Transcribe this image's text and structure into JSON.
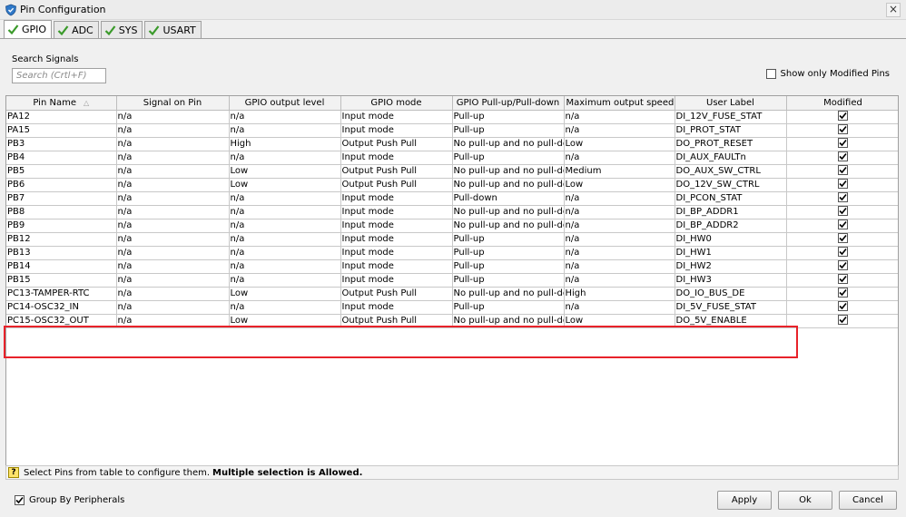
{
  "window": {
    "title": "Pin Configuration",
    "close_symbol": "×"
  },
  "tabs": [
    {
      "label": "GPIO",
      "icon": "check-icon",
      "active": true
    },
    {
      "label": "ADC",
      "icon": "check-icon",
      "active": false
    },
    {
      "label": "SYS",
      "icon": "check-icon",
      "active": false
    },
    {
      "label": "USART",
      "icon": "check-icon",
      "active": false
    }
  ],
  "search": {
    "label": "Search Signals",
    "placeholder": "Search (Crtl+F)",
    "value": ""
  },
  "show_modified": {
    "label": "Show only Modified Pins",
    "checked": false
  },
  "table": {
    "columns": [
      "Pin Name",
      "Signal on Pin",
      "GPIO output level",
      "GPIO mode",
      "GPIO Pull-up/Pull-down",
      "Maximum output speed",
      "User Label",
      "Modified"
    ],
    "sort_column": "Pin Name",
    "sort_glyph": "△",
    "rows": [
      {
        "pin": "PA12",
        "signal": "n/a",
        "level": "n/a",
        "mode": "Input mode",
        "pull": "Pull-up",
        "speed": "n/a",
        "label": "DI_12V_FUSE_STAT",
        "modified": true
      },
      {
        "pin": "PA15",
        "signal": "n/a",
        "level": "n/a",
        "mode": "Input mode",
        "pull": "Pull-up",
        "speed": "n/a",
        "label": "DI_PROT_STAT",
        "modified": true
      },
      {
        "pin": "PB3",
        "signal": "n/a",
        "level": "High",
        "mode": "Output Push Pull",
        "pull": "No pull-up and no pull-down",
        "speed": "Low",
        "label": "DO_PROT_RESET",
        "modified": true
      },
      {
        "pin": "PB4",
        "signal": "n/a",
        "level": "n/a",
        "mode": "Input mode",
        "pull": "Pull-up",
        "speed": "n/a",
        "label": "DI_AUX_FAULTn",
        "modified": true
      },
      {
        "pin": "PB5",
        "signal": "n/a",
        "level": "Low",
        "mode": "Output Push Pull",
        "pull": "No pull-up and no pull-down",
        "speed": "Medium",
        "label": "DO_AUX_SW_CTRL",
        "modified": true
      },
      {
        "pin": "PB6",
        "signal": "n/a",
        "level": "Low",
        "mode": "Output Push Pull",
        "pull": "No pull-up and no pull-down",
        "speed": "Low",
        "label": "DO_12V_SW_CTRL",
        "modified": true
      },
      {
        "pin": "PB7",
        "signal": "n/a",
        "level": "n/a",
        "mode": "Input mode",
        "pull": "Pull-down",
        "speed": "n/a",
        "label": "DI_PCON_STAT",
        "modified": true
      },
      {
        "pin": "PB8",
        "signal": "n/a",
        "level": "n/a",
        "mode": "Input mode",
        "pull": "No pull-up and no pull-down",
        "speed": "n/a",
        "label": "DI_BP_ADDR1",
        "modified": true
      },
      {
        "pin": "PB9",
        "signal": "n/a",
        "level": "n/a",
        "mode": "Input mode",
        "pull": "No pull-up and no pull-down",
        "speed": "n/a",
        "label": "DI_BP_ADDR2",
        "modified": true
      },
      {
        "pin": "PB12",
        "signal": "n/a",
        "level": "n/a",
        "mode": "Input mode",
        "pull": "Pull-up",
        "speed": "n/a",
        "label": "DI_HW0",
        "modified": true
      },
      {
        "pin": "PB13",
        "signal": "n/a",
        "level": "n/a",
        "mode": "Input mode",
        "pull": "Pull-up",
        "speed": "n/a",
        "label": "DI_HW1",
        "modified": true
      },
      {
        "pin": "PB14",
        "signal": "n/a",
        "level": "n/a",
        "mode": "Input mode",
        "pull": "Pull-up",
        "speed": "n/a",
        "label": "DI_HW2",
        "modified": true
      },
      {
        "pin": "PB15",
        "signal": "n/a",
        "level": "n/a",
        "mode": "Input mode",
        "pull": "Pull-up",
        "speed": "n/a",
        "label": "DI_HW3",
        "modified": true
      },
      {
        "pin": "PC13-TAMPER-RTC",
        "signal": "n/a",
        "level": "Low",
        "mode": "Output Push Pull",
        "pull": "No pull-up and no pull-down",
        "speed": "High",
        "label": "DO_IO_BUS_DE",
        "modified": true
      },
      {
        "pin": "PC14-OSC32_IN",
        "signal": "n/a",
        "level": "n/a",
        "mode": "Input mode",
        "pull": "Pull-up",
        "speed": "n/a",
        "label": "DI_5V_FUSE_STAT",
        "modified": true
      },
      {
        "pin": "PC15-OSC32_OUT",
        "signal": "n/a",
        "level": "Low",
        "mode": "Output Push Pull",
        "pull": "No pull-up and no pull-down",
        "speed": "Low",
        "label": "DO_5V_ENABLE",
        "modified": true
      }
    ]
  },
  "status": {
    "help_glyph": "?",
    "text": "Select Pins from table to configure them.",
    "bold_text": "Multiple selection is Allowed."
  },
  "group_by": {
    "label": "Group By Peripherals",
    "checked": true
  },
  "buttons": {
    "apply": "Apply",
    "ok": "Ok",
    "cancel": "Cancel"
  },
  "colors": {
    "highlight": "#e8222a",
    "check": "#3a9a2a",
    "app_icon": "#2f78c8"
  }
}
